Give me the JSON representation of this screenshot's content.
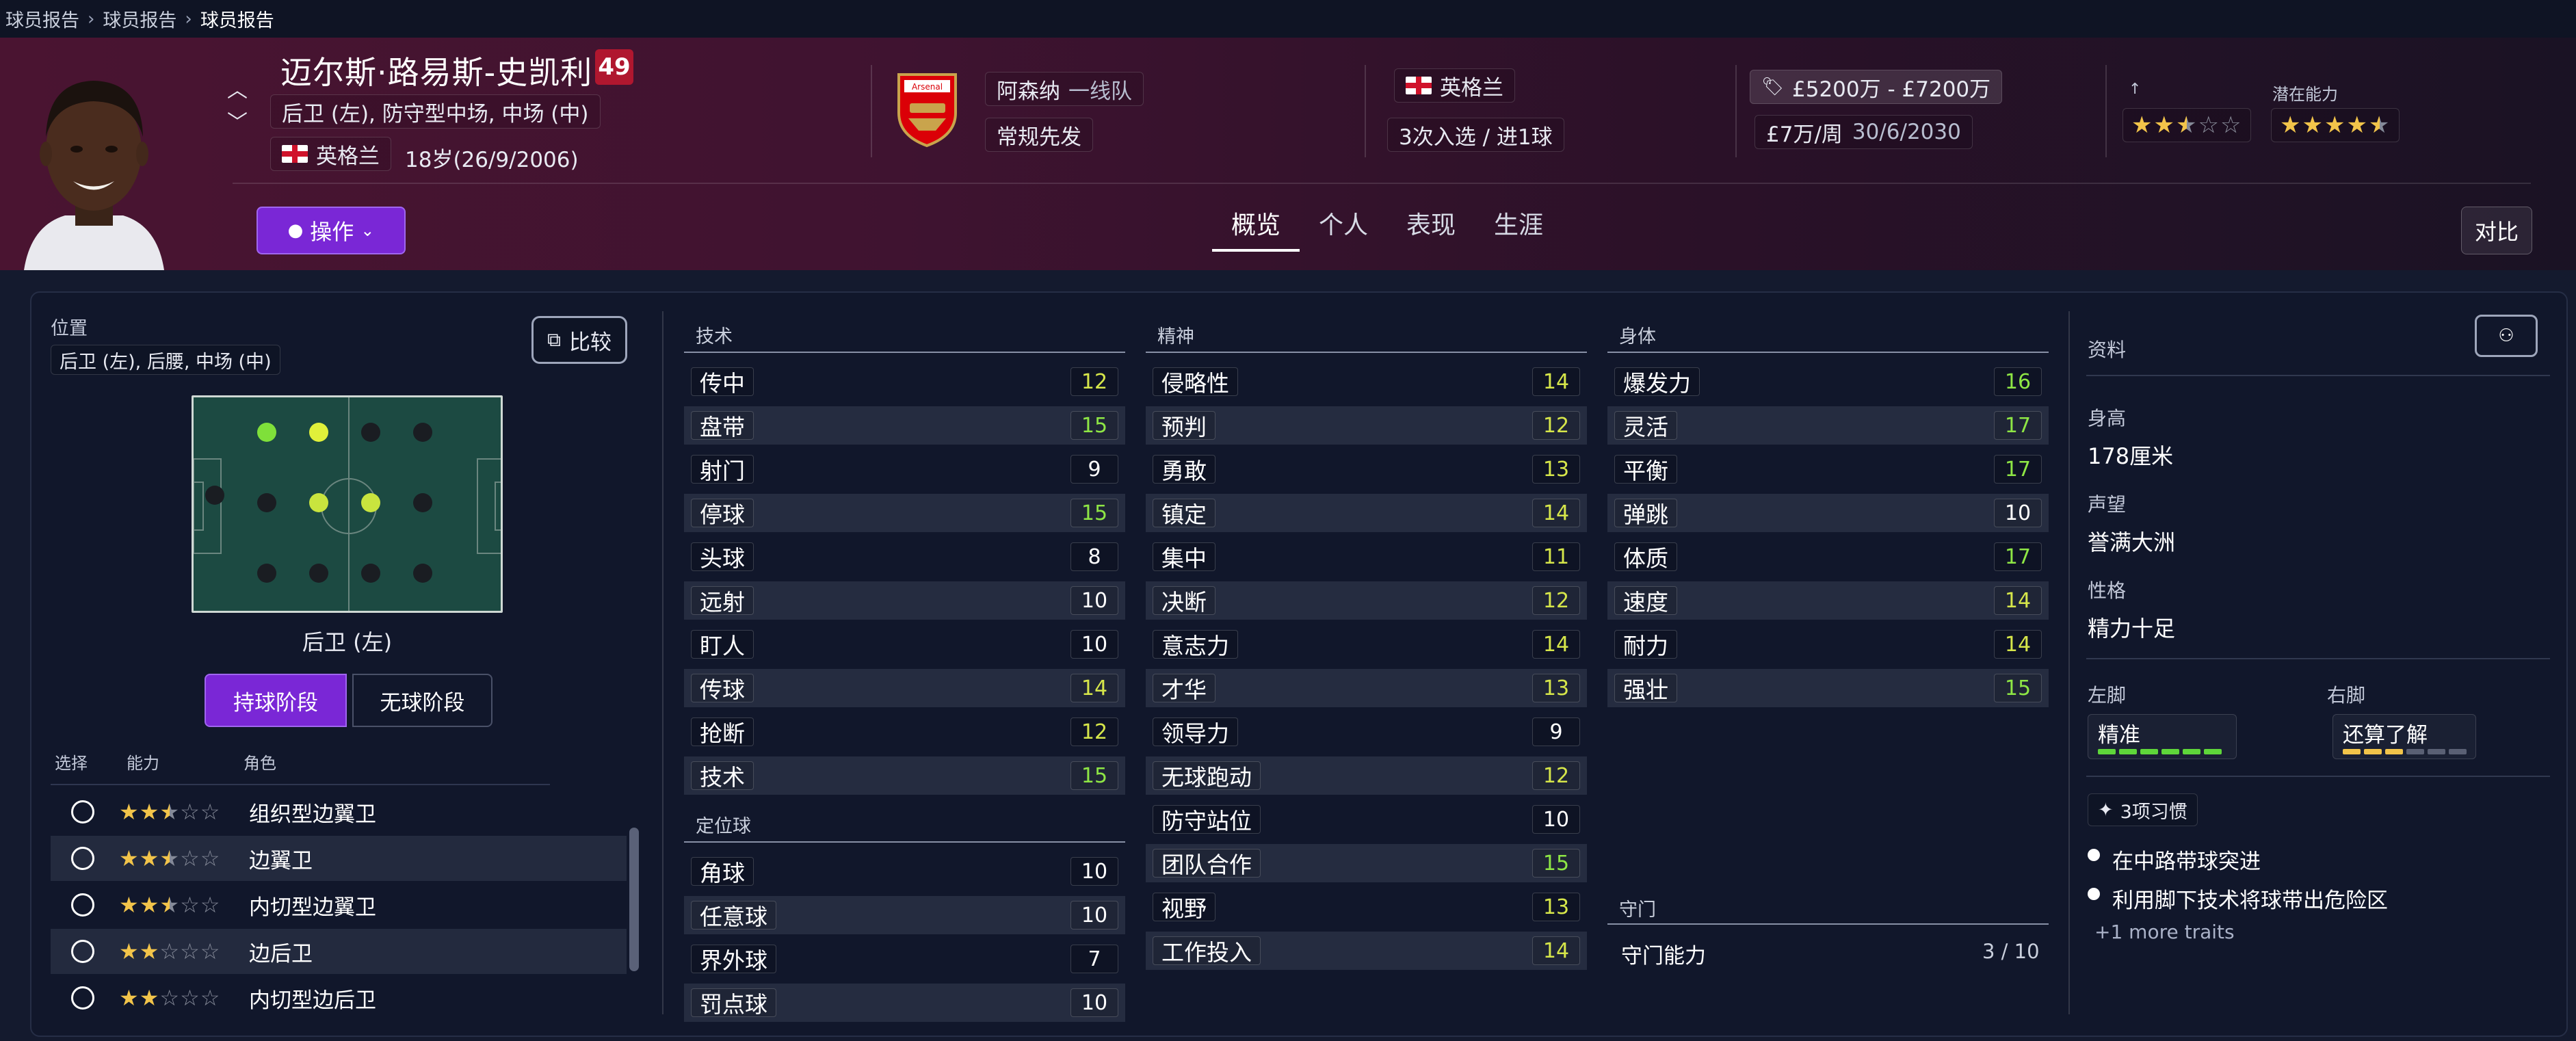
{
  "breadcrumb": {
    "items": [
      "球员报告",
      "球员报告",
      "球员报告"
    ]
  },
  "player": {
    "name": "迈尔斯·路易斯-史凯利",
    "ca": "49",
    "positions": "后卫 (左), 防守型中场, 中场 (中)",
    "nationality": "英格兰",
    "age": "18岁(26/9/2006)",
    "club": "阿森纳",
    "club_team": "一线队",
    "squad_status": "常规先发",
    "nation_flag_label": "英格兰",
    "caps": "3次入选 / 进1球",
    "value": "£5200万 - £7200万",
    "wage": "£7万/周",
    "contract": "30/6/2030",
    "ability_label": "↑",
    "potential_label": "潜在能力",
    "ability_stars": 2.5,
    "potential_stars": 4.5
  },
  "header": {
    "action_label": "操作",
    "compare_label": "对比",
    "tabs": [
      "概览",
      "个人",
      "表现",
      "生涯"
    ],
    "active_tab": 0
  },
  "position_panel": {
    "title": "位置",
    "positions_chip": "后卫 (左), 后腰, 中场 (中)",
    "compare_label": "比较",
    "selected_position": "后卫 (左)",
    "phase_in": "持球阶段",
    "phase_out": "无球阶段",
    "col_select": "选择",
    "col_ability": "能力",
    "col_role": "角色",
    "roles": [
      {
        "stars": 2.5,
        "name": "组织型边翼卫"
      },
      {
        "stars": 2.5,
        "name": "边翼卫"
      },
      {
        "stars": 2.5,
        "name": "内切型边翼卫"
      },
      {
        "stars": 2.0,
        "name": "边后卫"
      },
      {
        "stars": 2.0,
        "name": "内切型边后卫"
      }
    ]
  },
  "attributes": {
    "technical_title": "技术",
    "technical": [
      {
        "name": "传中",
        "value": 12
      },
      {
        "name": "盘带",
        "value": 15
      },
      {
        "name": "射门",
        "value": 9
      },
      {
        "name": "停球",
        "value": 15
      },
      {
        "name": "头球",
        "value": 8
      },
      {
        "name": "远射",
        "value": 10
      },
      {
        "name": "盯人",
        "value": 10
      },
      {
        "name": "传球",
        "value": 14
      },
      {
        "name": "抢断",
        "value": 12
      },
      {
        "name": "技术",
        "value": 15
      }
    ],
    "setpieces_title": "定位球",
    "setpieces": [
      {
        "name": "角球",
        "value": 10
      },
      {
        "name": "任意球",
        "value": 10
      },
      {
        "name": "界外球",
        "value": 7
      },
      {
        "name": "罚点球",
        "value": 10
      }
    ],
    "mental_title": "精神",
    "mental": [
      {
        "name": "侵略性",
        "value": 14
      },
      {
        "name": "预判",
        "value": 12
      },
      {
        "name": "勇敢",
        "value": 13
      },
      {
        "name": "镇定",
        "value": 14
      },
      {
        "name": "集中",
        "value": 11
      },
      {
        "name": "决断",
        "value": 12
      },
      {
        "name": "意志力",
        "value": 14
      },
      {
        "name": "才华",
        "value": 13
      },
      {
        "name": "领导力",
        "value": 9
      },
      {
        "name": "无球跑动",
        "value": 12
      },
      {
        "name": "防守站位",
        "value": 10
      },
      {
        "name": "团队合作",
        "value": 15
      },
      {
        "name": "视野",
        "value": 13
      },
      {
        "name": "工作投入",
        "value": 14
      }
    ],
    "physical_title": "身体",
    "physical": [
      {
        "name": "爆发力",
        "value": 16
      },
      {
        "name": "灵活",
        "value": 17
      },
      {
        "name": "平衡",
        "value": 17
      },
      {
        "name": "弹跳",
        "value": 10
      },
      {
        "name": "体质",
        "value": 17
      },
      {
        "name": "速度",
        "value": 14
      },
      {
        "name": "耐力",
        "value": 14
      },
      {
        "name": "强壮",
        "value": 15
      }
    ],
    "gk_title": "守门",
    "gk_label": "守门能力",
    "gk_value": "3 / 10"
  },
  "info": {
    "title": "资料",
    "height_label": "身高",
    "height": "178厘米",
    "reputation_label": "声望",
    "reputation": "誉满大洲",
    "personality_label": "性格",
    "personality": "精力十足",
    "left_foot_label": "左脚",
    "left_foot": "精准",
    "left_foot_level": 6,
    "right_foot_label": "右脚",
    "right_foot": "还算了解",
    "right_foot_level": 3,
    "traits_label": "3项习惯",
    "traits": [
      "在中路带球突进",
      "利用脚下技术将球带出危险区"
    ],
    "more_traits": "+1 more traits"
  },
  "colors": {
    "accent": "#7a27d6",
    "value_high": "#8ee645",
    "value_mid": "#d6e64a",
    "star": "#f2c44a",
    "arsenal": "#db0007"
  }
}
